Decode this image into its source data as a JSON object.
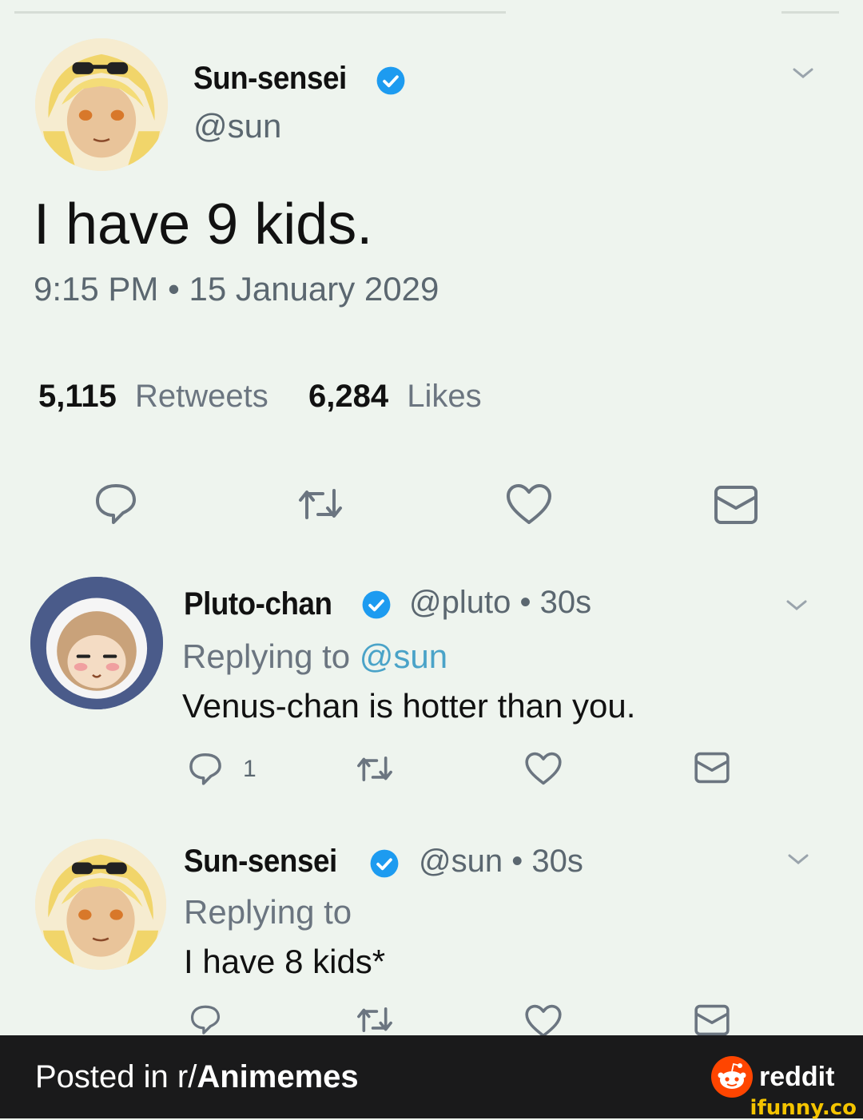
{
  "main_tweet": {
    "name": "Sun-sensei",
    "handle": "@sun",
    "text": "I have 9 kids.",
    "timestamp": "9:15 PM • 15 January 2029",
    "retweets_count": "5,115",
    "retweets_label": "Retweets",
    "likes_count": "6,284",
    "likes_label": "Likes"
  },
  "reply1": {
    "name": "Pluto-chan",
    "handle_time": "@pluto • 30s",
    "replying_prefix": "Replying to ",
    "replying_mention": "@sun",
    "text": "Venus-chan is hotter than you.",
    "reply_count": "1"
  },
  "reply2": {
    "name": "Sun-sensei",
    "handle_time": "@sun • 30s",
    "replying_prefix": "Replying to",
    "text": "I have 8 kids*"
  },
  "footer": {
    "posted_prefix": "Posted in r/",
    "subreddit": "Animemes",
    "reddit_label": "reddit",
    "watermark": "ifunny.co"
  },
  "icons": {
    "reply": "speech-bubble-icon",
    "retweet": "retweet-icon",
    "like": "heart-icon",
    "share": "envelope-icon",
    "more": "chevron-down-icon",
    "verified": "verified-badge-icon"
  },
  "colors": {
    "background": "#eef4ee",
    "verified_blue": "#1d9bf0",
    "mention": "#4aa3c8",
    "footer_bg": "#1a1a1b",
    "reddit_orange": "#ff4500"
  }
}
